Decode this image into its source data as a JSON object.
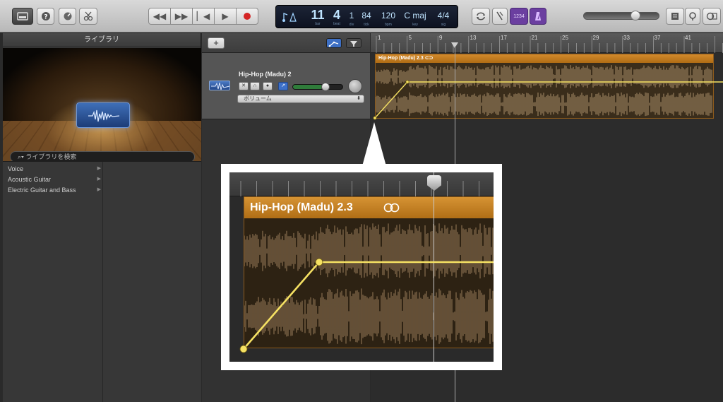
{
  "toolbar": {
    "library_label": "",
    "lcd": {
      "bar": "11",
      "bar_cap": "bar",
      "beat": "4",
      "beat_cap": "beat",
      "div": "1",
      "div_cap": "div",
      "tick": "84",
      "tick_cap": "tick",
      "tempo": "120",
      "tempo_cap": "bpm",
      "key": "C maj",
      "key_cap": "key",
      "signature": "4/4",
      "signature_cap": "sig"
    },
    "count_in_label": "1234",
    "colors": {
      "toolbar_bg": "#c8c8c8",
      "record": "#d42424",
      "lcd_text": "#bfe4ff",
      "purple_accent": "#6b3fa0"
    }
  },
  "library": {
    "title": "ライブラリ",
    "search_placeholder": "ライブラリを検索",
    "items": [
      {
        "label": "Voice"
      },
      {
        "label": "Acoustic Guitar"
      },
      {
        "label": "Electric Guitar and Bass"
      }
    ]
  },
  "tracks": {
    "add_label": "+",
    "track": {
      "name": "Hip-Hop (Madu) 2",
      "automation_param": "ボリューム",
      "volume_level": 0.58
    }
  },
  "timeline": {
    "ruler_numbers": [
      "1",
      "5",
      "9",
      "13",
      "17",
      "21",
      "25",
      "29",
      "33",
      "37",
      "41"
    ],
    "region_name": "Hip-Hop (Madu) 2.3",
    "region_color": "#c07a20",
    "automation_color": "#f5e163"
  },
  "callout": {
    "region_name": "Hip-Hop (Madu) 2.3"
  }
}
